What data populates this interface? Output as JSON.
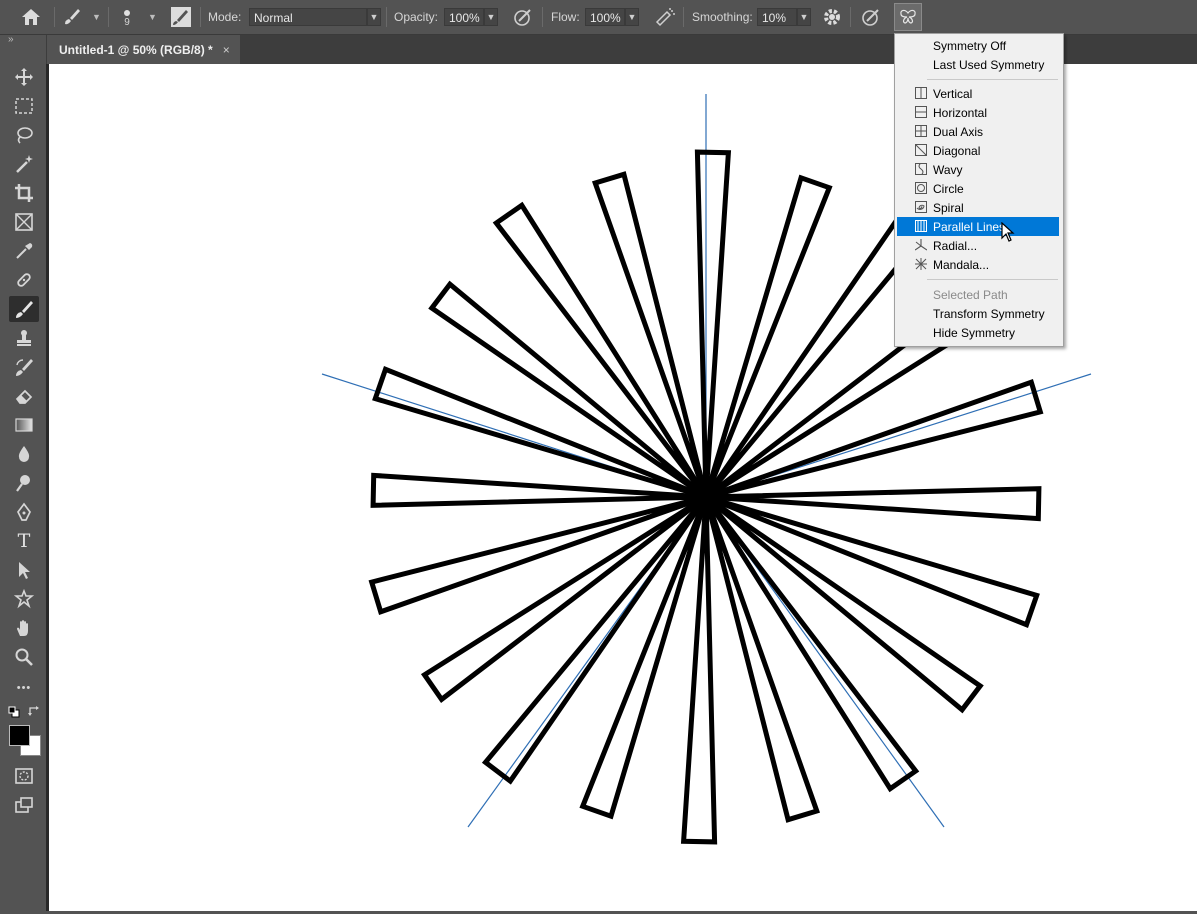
{
  "options_bar": {
    "brush_size": "9",
    "mode_label": "Mode:",
    "mode_value": "Normal",
    "opacity_label": "Opacity:",
    "opacity_value": "100%",
    "flow_label": "Flow:",
    "flow_value": "100%",
    "smoothing_label": "Smoothing:",
    "smoothing_value": "10%"
  },
  "document": {
    "tab_title": "Untitled-1 @ 50% (RGB/8) *",
    "close_glyph": "×"
  },
  "tools": [
    "move-icon",
    "marquee-icon",
    "lasso-icon",
    "magic-wand-icon",
    "crop-icon",
    "frame-icon",
    "eyedropper-icon",
    "healing-brush-icon",
    "brush-icon",
    "clone-stamp-icon",
    "history-brush-icon",
    "eraser-icon",
    "gradient-icon",
    "blur-icon",
    "dodge-icon",
    "pen-icon",
    "type-icon",
    "path-selection-icon",
    "shape-icon",
    "hand-icon",
    "zoom-icon",
    "more-tools-icon"
  ],
  "tools_text": {
    "type_glyph": "T",
    "more_glyph": "•••",
    "expand_glyph": "»"
  },
  "symmetry_menu": {
    "group1": [
      "Symmetry Off",
      "Last Used Symmetry"
    ],
    "group2": [
      "Vertical",
      "Horizontal",
      "Dual Axis",
      "Diagonal",
      "Wavy",
      "Circle",
      "Spiral",
      "Parallel Lines",
      "Radial...",
      "Mandala..."
    ],
    "group3": [
      "Selected Path",
      "Transform Symmetry",
      "Hide Symmetry"
    ],
    "highlighted": "Parallel Lines",
    "disabled": "Selected Path"
  },
  "colors": {
    "ui_bg": "#535353",
    "highlight": "#0078d7",
    "guide_line": "#2f6fb5",
    "foreground": "#000000",
    "background": "#ffffff"
  }
}
